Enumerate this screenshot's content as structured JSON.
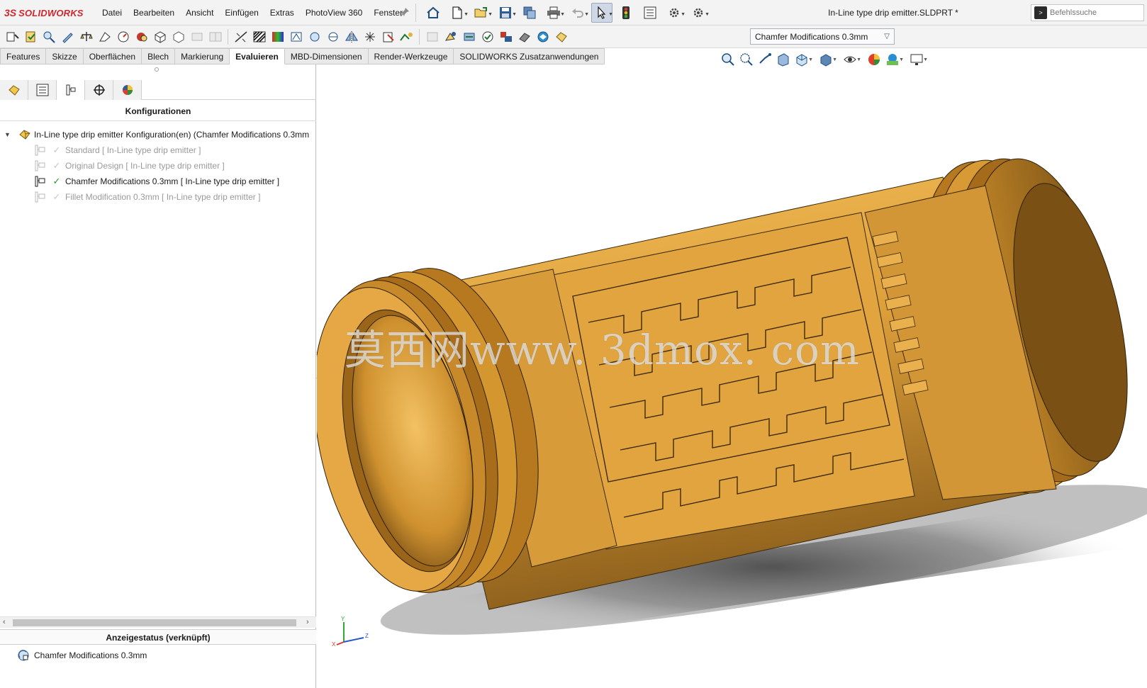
{
  "app": {
    "logo_prefix": "3S",
    "logo_text": "SOLIDWORKS",
    "brand_color": "#d0262d"
  },
  "menu": [
    "Datei",
    "Bearbeiten",
    "Ansicht",
    "Einfügen",
    "Extras",
    "PhotoView 360",
    "Fenster"
  ],
  "document": {
    "title": "In-Line type drip emitter.SLDPRT *"
  },
  "search": {
    "placeholder": "Befehlssuche"
  },
  "configuration_dropdown": {
    "value": "Chamfer Modifications 0.3mm"
  },
  "tabs": [
    {
      "label": "Features",
      "active": false
    },
    {
      "label": "Skizze",
      "active": false
    },
    {
      "label": "Oberflächen",
      "active": false
    },
    {
      "label": "Blech",
      "active": false
    },
    {
      "label": "Markierung",
      "active": false
    },
    {
      "label": "Evaluieren",
      "active": true
    },
    {
      "label": "MBD-Dimensionen",
      "active": false
    },
    {
      "label": "Render-Werkzeuge",
      "active": false
    },
    {
      "label": "SOLIDWORKS Zusatzanwendungen",
      "active": false
    }
  ],
  "left_panel": {
    "header": "Konfigurationen",
    "tree_root": "In-Line type drip emitter Konfiguration(en)  (Chamfer Modifications 0.3mm",
    "configurations": [
      {
        "label": "Standard [ In-Line type drip emitter ]",
        "active": false
      },
      {
        "label": "Original Design [ In-Line type drip emitter ]",
        "active": false
      },
      {
        "label": "Chamfer Modifications 0.3mm [ In-Line type drip emitter ]",
        "active": true
      },
      {
        "label": "Fillet Modification 0.3mm [ In-Line type drip emitter ]",
        "active": false
      }
    ],
    "status_header": "Anzeigestatus (verknüpft)",
    "status_item": "Chamfer Modifications 0.3mm"
  },
  "viewport": {
    "watermark": "莫西网www. 3dmox. com",
    "triad_labels": {
      "x": "X",
      "y": "Y",
      "z": "Z"
    },
    "model_color": "#d9992e"
  }
}
